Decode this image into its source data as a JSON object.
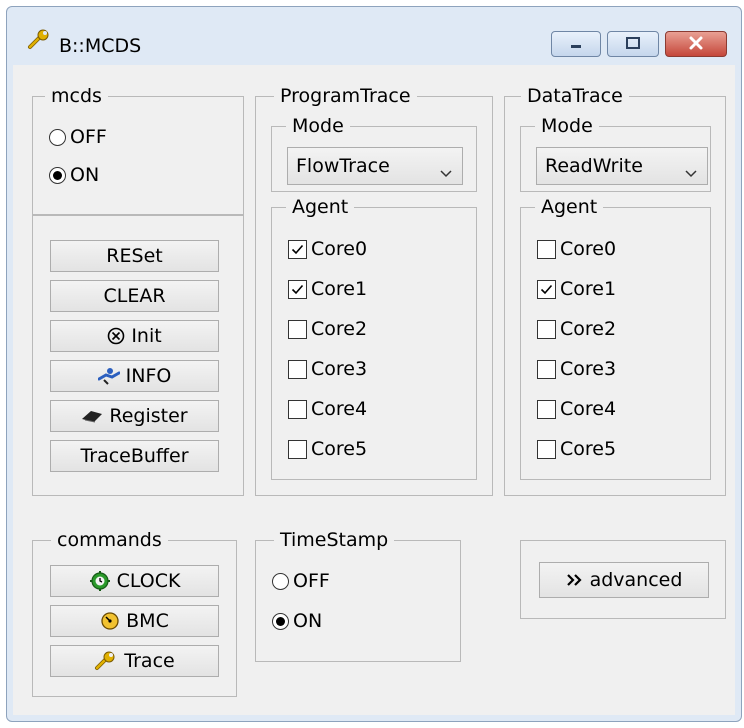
{
  "window": {
    "title": "B::MCDS"
  },
  "mcds": {
    "label": "mcds",
    "options": [
      "OFF",
      "ON"
    ],
    "selected": "ON",
    "buttons": {
      "reset": "RESet",
      "clear": "CLEAR",
      "init": "Init",
      "info": "INFO",
      "register": "Register",
      "tracebuffer": "TraceBuffer"
    }
  },
  "program_trace": {
    "label": "ProgramTrace",
    "mode_label": "Mode",
    "mode_value": "FlowTrace",
    "agent_label": "Agent",
    "agents": [
      {
        "label": "Core0",
        "checked": true
      },
      {
        "label": "Core1",
        "checked": true
      },
      {
        "label": "Core2",
        "checked": false
      },
      {
        "label": "Core3",
        "checked": false
      },
      {
        "label": "Core4",
        "checked": false
      },
      {
        "label": "Core5",
        "checked": false
      }
    ]
  },
  "data_trace": {
    "label": "DataTrace",
    "mode_label": "Mode",
    "mode_value": "ReadWrite",
    "agent_label": "Agent",
    "agents": [
      {
        "label": "Core0",
        "checked": false
      },
      {
        "label": "Core1",
        "checked": true
      },
      {
        "label": "Core2",
        "checked": false
      },
      {
        "label": "Core3",
        "checked": false
      },
      {
        "label": "Core4",
        "checked": false
      },
      {
        "label": "Core5",
        "checked": false
      }
    ]
  },
  "commands": {
    "label": "commands",
    "buttons": {
      "clock": "CLOCK",
      "bmc": "BMC",
      "trace": "Trace"
    }
  },
  "timestamp": {
    "label": "TimeStamp",
    "options": [
      "OFF",
      "ON"
    ],
    "selected": "ON"
  },
  "advanced": {
    "label": "advanced"
  },
  "colors": {
    "title_bg": "#dfe9f5",
    "client_bg": "#f0f0f0",
    "close_red": "#c5473a",
    "icon_yellow": "#e0b000",
    "icon_green": "#2a9a2a",
    "icon_blue": "#2b5fbf"
  },
  "icons": {
    "title": "wrench-icon",
    "init": "circled-x-icon",
    "info": "info-hand-icon",
    "register": "register-chip-icon",
    "clock": "clock-gear-icon",
    "bmc": "bmc-gauge-icon",
    "trace": "wrench-icon",
    "advanced": "double-chevron-right-icon"
  }
}
